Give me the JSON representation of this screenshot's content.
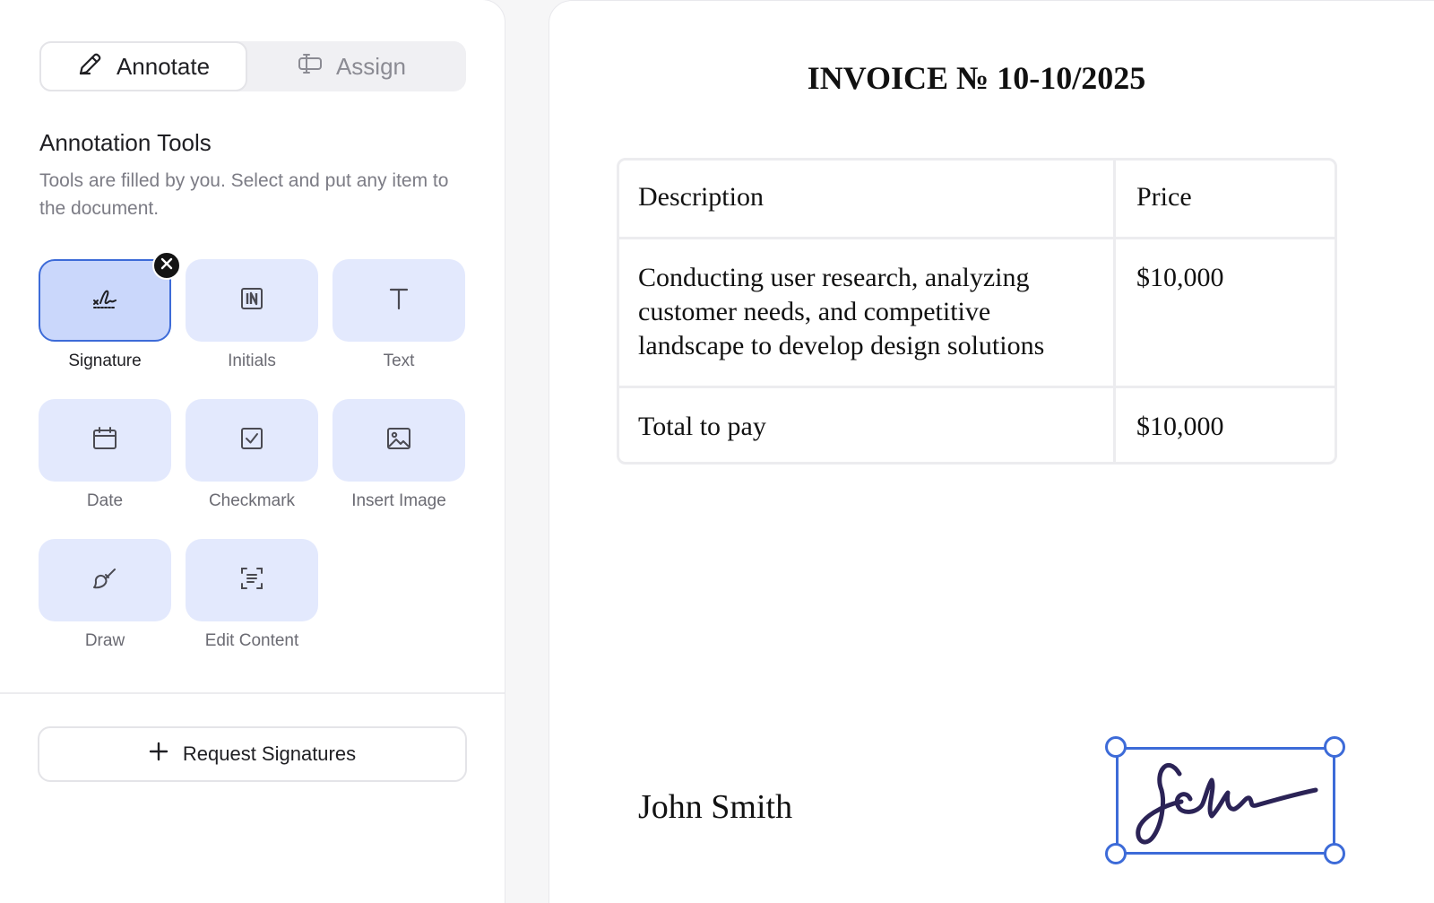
{
  "tabs": {
    "annotate_label": "Annotate",
    "assign_label": "Assign"
  },
  "annotation": {
    "title": "Annotation Tools",
    "description": "Tools are filled by you. Select and put any item to the document."
  },
  "tools": {
    "signature": "Signature",
    "initials": "Initials",
    "text": "Text",
    "date": "Date",
    "checkmark": "Checkmark",
    "insert_image": "Insert Image",
    "draw": "Draw",
    "edit_content": "Edit Content"
  },
  "selected_tool": "Signature",
  "request_button": "Request Signatures",
  "document": {
    "title": "INVOICE № 10-10/2025",
    "table": {
      "headers": [
        "Description",
        "Price"
      ],
      "rows": [
        [
          "Conducting user research, analyzing customer needs, and competitive landscape to develop design solutions",
          "$10,000"
        ],
        [
          "Total to pay",
          "$10,000"
        ]
      ]
    },
    "signer_name": "John Smith"
  },
  "colors": {
    "accent": "#3d6bd8",
    "tool_bg": "#e3e9fd",
    "tool_selected_bg": "#cad7fb",
    "signature_ink": "#2b2356"
  },
  "icons": [
    "pen-icon",
    "assign-icon",
    "signature-icon",
    "initials-icon",
    "text-icon",
    "calendar-icon",
    "checkbox-icon",
    "image-icon",
    "brush-icon",
    "edit-content-icon",
    "close-icon",
    "plus-icon"
  ]
}
